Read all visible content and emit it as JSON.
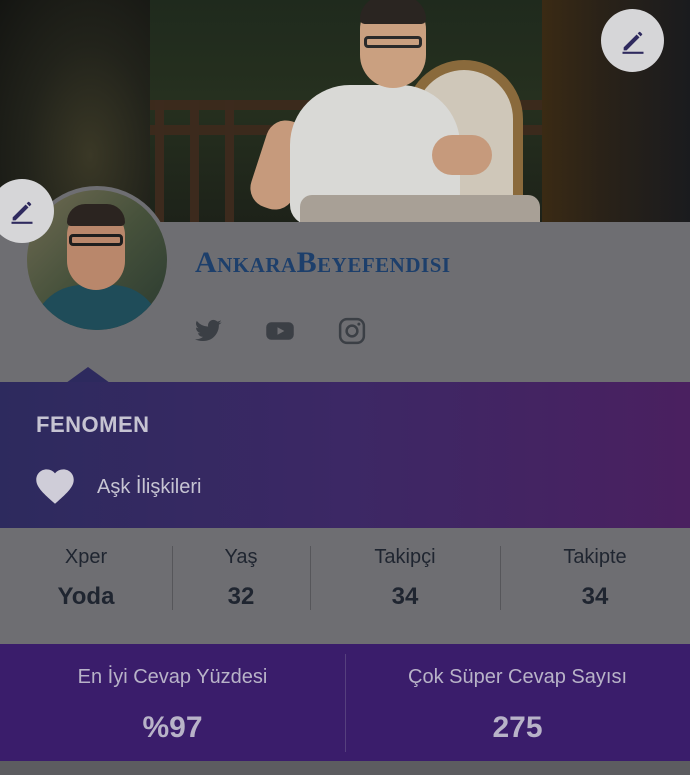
{
  "profile": {
    "username": "AnkaraBeyefendisi",
    "socials": [
      {
        "icon": "twitter-icon"
      },
      {
        "icon": "youtube-icon"
      },
      {
        "icon": "instagram-icon"
      }
    ]
  },
  "banner": {
    "title": "FENOMEN",
    "topic_icon": "heart-icon",
    "topic": "Aşk İlişkileri"
  },
  "stats": [
    {
      "label": "Xper",
      "value": "Yoda"
    },
    {
      "label": "Yaş",
      "value": "32"
    },
    {
      "label": "Takipçi",
      "value": "34"
    },
    {
      "label": "Takipte",
      "value": "34"
    }
  ],
  "metrics": [
    {
      "label": "En İyi Cevap Yüzdesi",
      "value": "%97"
    },
    {
      "label": "Çok Süper Cevap Sayısı",
      "value": "275"
    }
  ],
  "colors": {
    "username": "#1d3f6b",
    "banner_start": "#2d2a5e",
    "banner_end": "#4a2060",
    "metrics_bg": "#3a1d6b",
    "overlay_gray": "#6e6e72"
  }
}
